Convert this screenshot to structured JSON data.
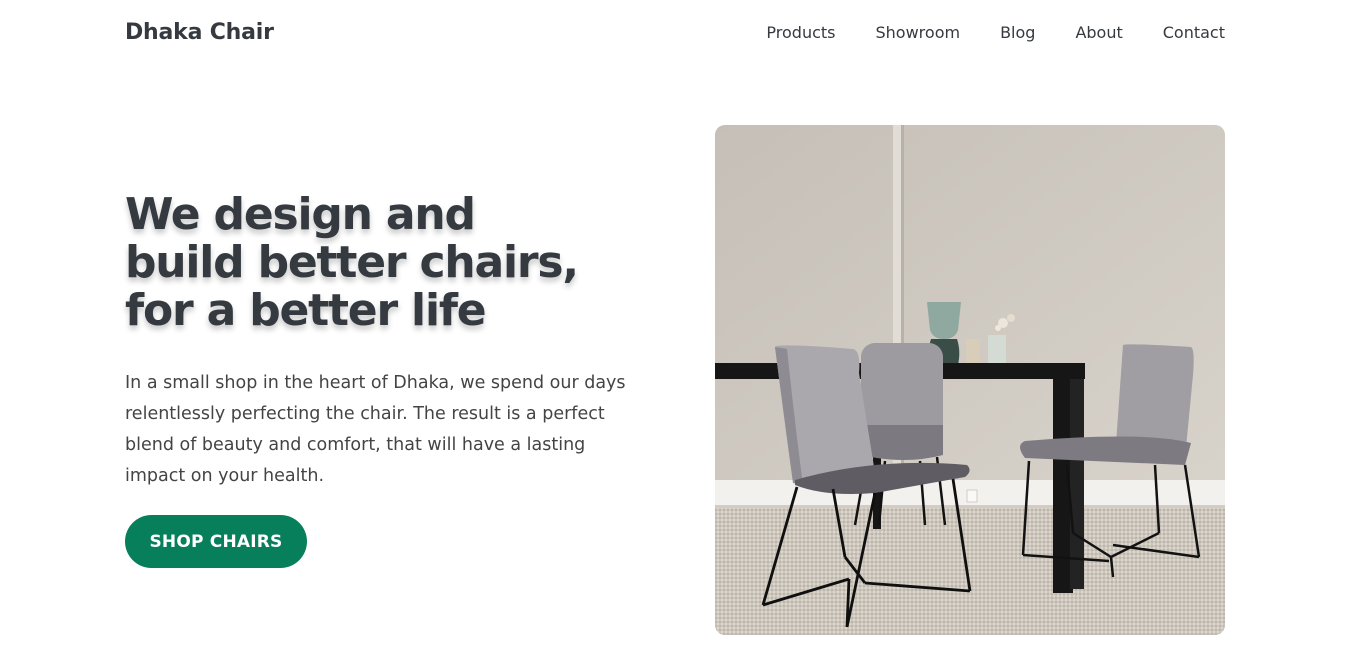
{
  "header": {
    "logo": "Dhaka Chair",
    "nav": [
      {
        "label": "Products"
      },
      {
        "label": "Showroom"
      },
      {
        "label": "Blog"
      },
      {
        "label": "About"
      },
      {
        "label": "Contact"
      }
    ]
  },
  "hero": {
    "title": "We design and build better chairs, for a better life",
    "description": "In a small shop in the heart of Dhaka, we spend our days relentlessly perfecting the chair. The result is a perfect blend of beauty and comfort, that will have a lasting impact on your health.",
    "cta_label": "SHOP CHAIRS"
  },
  "colors": {
    "accent": "#087f5b",
    "text": "#343a40"
  }
}
